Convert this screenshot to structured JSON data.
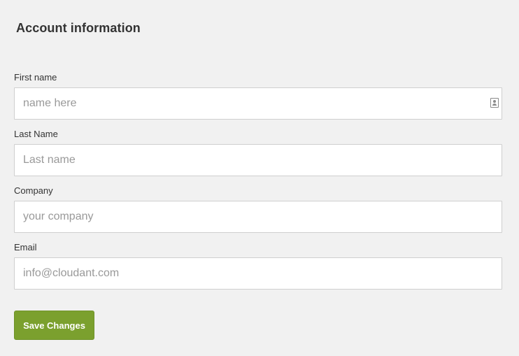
{
  "section": {
    "title": "Account information"
  },
  "form": {
    "first_name": {
      "label": "First name",
      "value": "",
      "placeholder": "name here",
      "icon": "contact-card-icon"
    },
    "last_name": {
      "label": "Last Name",
      "value": "",
      "placeholder": "Last name"
    },
    "company": {
      "label": "Company",
      "value": "",
      "placeholder": "your company"
    },
    "email": {
      "label": "Email",
      "value": "",
      "placeholder": "info@cloudant.com"
    },
    "save_label": "Save Changes"
  },
  "colors": {
    "background": "#f1f1f1",
    "button": "#7ba02e",
    "field_border": "#cfcfcf"
  }
}
